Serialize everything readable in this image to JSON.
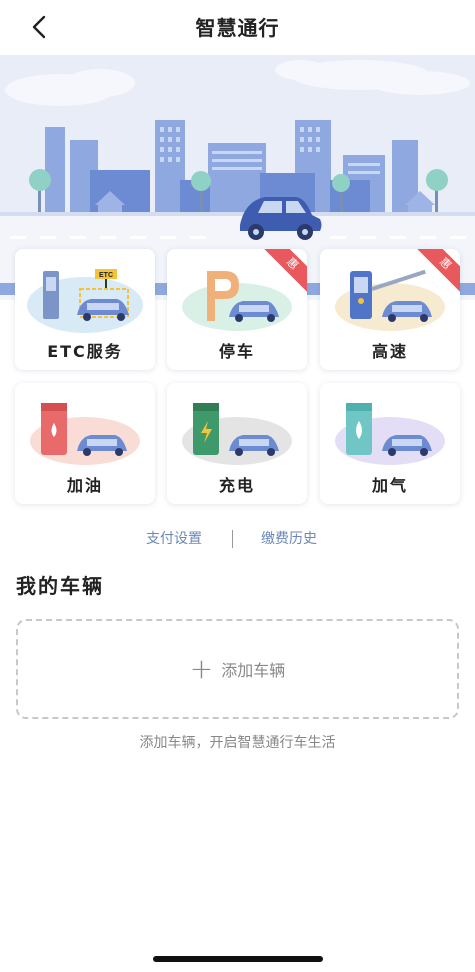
{
  "header": {
    "title": "智慧通行"
  },
  "hero": {
    "sign_text": "ETC"
  },
  "services": [
    {
      "label": "ETC服务",
      "badge": ""
    },
    {
      "label": "停车",
      "badge": "惠"
    },
    {
      "label": "高速",
      "badge": "惠"
    },
    {
      "label": "加油",
      "badge": ""
    },
    {
      "label": "充电",
      "badge": ""
    },
    {
      "label": "加气",
      "badge": ""
    }
  ],
  "links": {
    "payment_settings": "支付设置",
    "payment_history": "缴费历史"
  },
  "vehicles": {
    "section_title": "我的车辆",
    "add_label": "添加车辆",
    "hint": "添加车辆，开启智慧通行车生活"
  },
  "colors": {
    "accent_link": "#6b88b8",
    "badge": "#e8585c",
    "hero_bg": "#e9edf8"
  }
}
